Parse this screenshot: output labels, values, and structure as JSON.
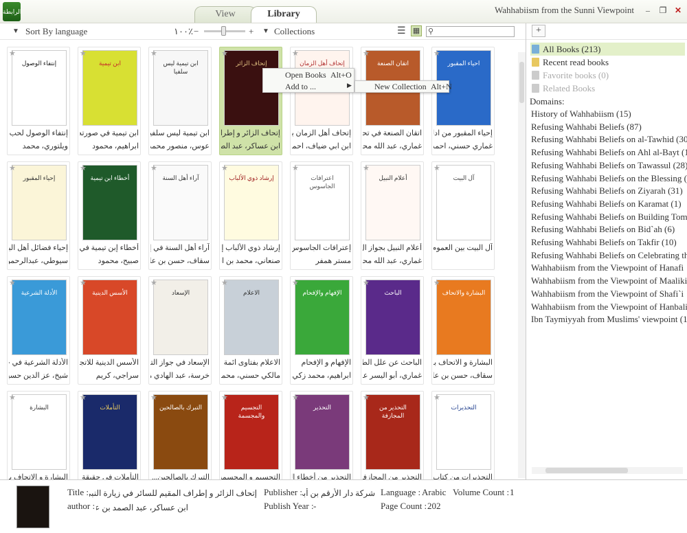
{
  "app": {
    "logo_text": "الرابطة",
    "window_title": "Wahhabiism from the Sunni Viewpoint"
  },
  "tabs": [
    {
      "label": "View"
    },
    {
      "label": "Library"
    }
  ],
  "toolbar": {
    "sort_label": "Sort By language",
    "zoom": "١٠٠٪",
    "minus": "−",
    "plus": "+",
    "collections_label": "Collections",
    "search_placeholder": ""
  },
  "books": [
    {
      "cover_title": "إنتفاء الوصول",
      "cover_color": "#ffffff",
      "text_color": "#222",
      "cap1": "إنتفاء الوصول لحب ا...",
      "cap2": "ويلتوري، محمد"
    },
    {
      "cover_title": "ابن تيمية",
      "cover_color": "#d8e033",
      "text_color": "#c62828",
      "cap1": "ابن تيمية في صورته ا...",
      "cap2": "ابراهيم، محمود"
    },
    {
      "cover_title": "ابن تيمية ليس سلفيا",
      "cover_color": "#f7f7f7",
      "text_color": "#333",
      "cap1": "ابن تيمية ليس سلفيا",
      "cap2": "عوس، منصور محمد..."
    },
    {
      "cover_title": "إتحاف الزائر",
      "cover_color": "#3a1010",
      "text_color": "#e0c080",
      "cap1": "إتحاف الزائر و إطراف...",
      "cap2": "ابن عساكر، عبد الصم..."
    },
    {
      "cover_title": "إتحاف أهل الزمان",
      "cover_color": "#fff4ee",
      "text_color": "#b03030",
      "cap1": "إتحاف أهل الزمان بأ...",
      "cap2": "ابن ابي ضياف، احمد"
    },
    {
      "cover_title": "اتقان الصنعة",
      "cover_color": "#b85a2a",
      "text_color": "#fff",
      "cap1": "اتقان الصنعة في تحقي...",
      "cap2": "غماري، عبد الله محمد..."
    },
    {
      "cover_title": "احياء المقبور",
      "cover_color": "#2a6ac8",
      "text_color": "#fff",
      "cap1": "إحياء المقبور من ادلة ...",
      "cap2": "غماري حسني، احمد"
    },
    {
      "cover_title": "إحياء المقبور",
      "cover_color": "#fbf5d8",
      "text_color": "#333",
      "cap1": "إحياء فضائل أهل البي...",
      "cap2": "سيوطي، عبدالرحمن بن..."
    },
    {
      "cover_title": "أخطاء ابن تيمية",
      "cover_color": "#1f5a2a",
      "text_color": "#fff",
      "cap1": "أخطاء إبن تيمية في ...",
      "cap2": "صبيح، محمود"
    },
    {
      "cover_title": "آراء أهل السنة",
      "cover_color": "#fafafa",
      "text_color": "#333",
      "cap1": "آراء أهل السنة في إبن...",
      "cap2": "سقاف، حسن بن علي"
    },
    {
      "cover_title": "إرشاد ذوي الألباب",
      "cover_color": "#fffbe0",
      "text_color": "#a02020",
      "cap1": "إرشاد ذوي الألباب إلى...",
      "cap2": "صنعاني، محمد بن اس..."
    },
    {
      "cover_title": "اعترافات الجاسوس",
      "cover_color": "#ffffff",
      "text_color": "#555",
      "cap1": "إعترافات الجاسوس الا...",
      "cap2": "مستر همفر"
    },
    {
      "cover_title": "أعلام النبيل",
      "cover_color": "#fff8f4",
      "text_color": "#333",
      "cap1": "أعلام النبيل بجواز ال...",
      "cap2": "غماري، عبد الله محمد..."
    },
    {
      "cover_title": "آل البيت",
      "cover_color": "#ffffff",
      "text_color": "#444",
      "cap1": "آل البيت بين العموم و...",
      "cap2": ""
    },
    {
      "cover_title": "الأدلة الشرعية",
      "cover_color": "#3a9ad8",
      "text_color": "#fff",
      "cap1": "الأدلة الشرعية في جوا...",
      "cap2": "شيخ، عز الدين حسين"
    },
    {
      "cover_title": "الأسس الدينية",
      "cover_color": "#d84828",
      "text_color": "#fff",
      "cap1": "الأسس الدينية للاتجا...",
      "cap2": "سراجي، كريم"
    },
    {
      "cover_title": "الإسعاد",
      "cover_color": "#f2efe8",
      "text_color": "#333",
      "cap1": "الإسعاد في جواز التو...",
      "cap2": "خرسة، عبد الهادي محمد"
    },
    {
      "cover_title": "الاعلام",
      "cover_color": "#c8d0d8",
      "text_color": "#333",
      "cap1": "الاعلام بفتاوى ائمة ا...",
      "cap2": "مالكي حسني، محمد"
    },
    {
      "cover_title": "الإفهام والإفحام",
      "cover_color": "#3aa83a",
      "text_color": "#fff",
      "cap1": "الإفهام و الإفحام",
      "cap2": "ابراهيم، محمد زكي"
    },
    {
      "cover_title": "الباحث",
      "cover_color": "#5a2a8a",
      "text_color": "#fff",
      "cap1": "الباحث عن علل الطع...",
      "cap2": "غماري، أبو اليسر عبد..."
    },
    {
      "cover_title": "البشارة والاتحاف",
      "cover_color": "#e87a20",
      "text_color": "#fff",
      "cap1": "البشارة و الاتحاف بما...",
      "cap2": "سقاف، حسن بن علي"
    },
    {
      "cover_title": "البشارة",
      "cover_color": "#ffffff",
      "text_color": "#333",
      "cap1": "البشارة و الاتحاف بما...",
      "cap2": ""
    },
    {
      "cover_title": "التأملات",
      "cover_color": "#1a2a6a",
      "text_color": "#f0d060",
      "cap1": "التأملات في حقيقة ا...",
      "cap2": ""
    },
    {
      "cover_title": "التبرك بالصالحين",
      "cover_color": "#8a4a10",
      "text_color": "#fff",
      "cap1": "التبرك بالصالحين...",
      "cap2": ""
    },
    {
      "cover_title": "التجسيم والمجسمة",
      "cover_color": "#b8241a",
      "text_color": "#fff",
      "cap1": "التجسيم و المجسمة...",
      "cap2": ""
    },
    {
      "cover_title": "التحذير",
      "cover_color": "#7a3a7a",
      "text_color": "#fff",
      "cap1": "التحذير من أخطاء النا...",
      "cap2": ""
    },
    {
      "cover_title": "التحذير من المجازفة",
      "cover_color": "#a8281a",
      "text_color": "#fff",
      "cap1": "التحذير من المجازفة...",
      "cap2": ""
    },
    {
      "cover_title": "التحذيرات",
      "cover_color": "#ffffff",
      "text_color": "#1a3a8a",
      "cap1": "التحذيرات من كتاب إب...",
      "cap2": ""
    }
  ],
  "context_menu": {
    "open": "Open Books",
    "open_shortcut": "Alt+O",
    "add_to": "Add to ...",
    "sub_new": "New Collection",
    "sub_shortcut": "Alt+N"
  },
  "sidebar": {
    "libs": [
      {
        "label": "All Books (213)",
        "color": "#7ab0d8"
      },
      {
        "label": "Recent read books",
        "color": "#e8c860"
      },
      {
        "label": "Favorite books (0)",
        "color": "#cccccc"
      },
      {
        "label": "Related Books",
        "color": "#cccccc"
      }
    ],
    "domains_title": "Domains:",
    "domains": [
      "History of Wahhabiism (15)",
      "Refusing Wahhabi Beliefs (87)",
      "Refusing Wahhabi Beliefs on al-Tawhid (30)",
      "Refusing Wahhabi Beliefs on Ahl al-Bayt (1)",
      "Refusing Wahhabi Beliefs on Tawassul (28)",
      "Refusing Wahhabi Beliefs on the Blessing (9)",
      "Refusing Wahhabi Beliefs on Ziyarah (31)",
      "Refusing Wahhabi Beliefs on Karamat (1)",
      "Refusing Wahhabi Beliefs on Building Tomb",
      "Refusing Wahhabi Beliefs on Bid`ah (6)",
      "Refusing Wahhabi Beliefs on Takfir (10)",
      "Refusing Wahhabi Beliefs on Celebrating th",
      "Wahhabiism from the Viewpoint of Hanafi",
      "Wahhabiism from the Viewpoint of Maaliki",
      "Wahhabiism from the Viewpoint of Shafi`i",
      "Wahhabiism from the Viewpoint of Hanbali",
      "Ibn Taymiyyah from Muslims' viewpoint (1"
    ]
  },
  "details": {
    "title_label": "Title :",
    "title_value": "إتحاف الزائر و إطراف المقيم للسائر في زيارة النبي صلي اللهُ عليه و سلم",
    "author_label": "author :",
    "author_value": "ابن عساكر، عبد الصمد بن عبد الوهاب",
    "publisher_label": "Publisher :",
    "publisher_value": "شركة دار الأرقم بن أبي الأرقم",
    "year_label": "Publish Year :",
    "year_value": "-",
    "language_label": "Language :",
    "language_value": "Arabic",
    "volume_label": "Volume Count :",
    "volume_value": "1",
    "page_label": "Page Count :",
    "page_value": "202"
  }
}
